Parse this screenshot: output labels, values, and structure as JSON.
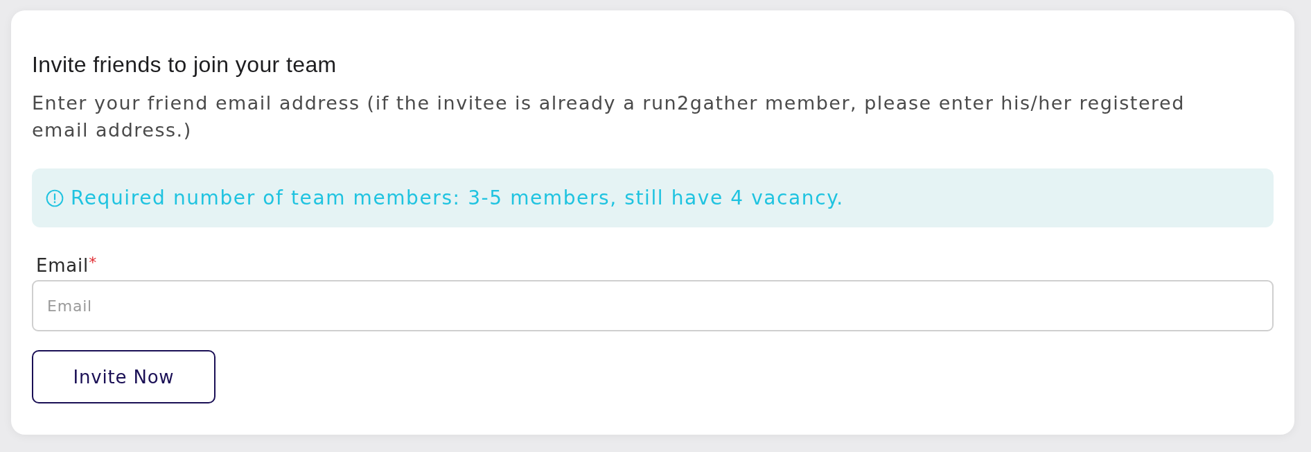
{
  "card": {
    "title": "Invite friends to join your team",
    "description": "Enter your friend email address (if the invitee is already a run2gather member, please enter his/her registered email address.)"
  },
  "alert": {
    "kind": "info",
    "text": "Required number of team members: 3-5 members, still have 4 vacancy."
  },
  "form": {
    "fields": [
      {
        "label": "Email",
        "required_mark": "*",
        "placeholder": "Email"
      }
    ]
  },
  "buttons": [
    {
      "label": "Invite Now"
    }
  ]
}
